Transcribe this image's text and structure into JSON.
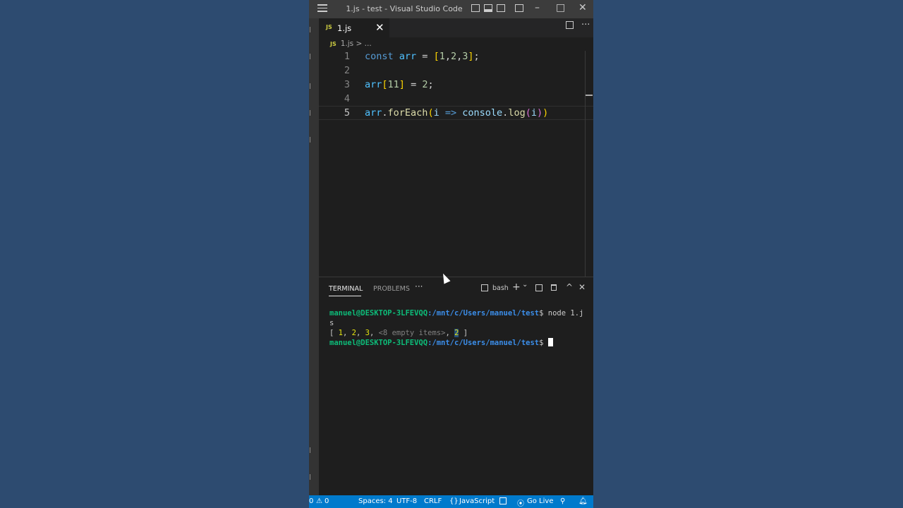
{
  "window": {
    "title": "1.js - test - Visual Studio Code",
    "minimize": "–",
    "maximize": "□",
    "close": "✕"
  },
  "tabs": [
    {
      "icon": "JS",
      "label": "1.js",
      "close": "✕"
    }
  ],
  "tab_actions": {
    "more": "···"
  },
  "breadcrumb": {
    "icon": "JS",
    "file": "1.js",
    "sep": ">",
    "more": "..."
  },
  "editor": {
    "lines": [
      {
        "n": "1",
        "text": "const arr = [1,2,3];"
      },
      {
        "n": "2",
        "text": ""
      },
      {
        "n": "3",
        "text": "arr[11] = 2;"
      },
      {
        "n": "4",
        "text": ""
      },
      {
        "n": "5",
        "text": "arr.forEach(i => console.log(i))"
      }
    ],
    "current_line": "5"
  },
  "panel": {
    "tabs": [
      {
        "label": "TERMINAL",
        "active": true
      },
      {
        "label": "PROBLEMS",
        "active": false
      }
    ],
    "more": "···",
    "shell": "bash",
    "add": "+",
    "dropdown": "⌄",
    "maximize": "^",
    "close": "✕",
    "terminal": {
      "user": "manuel@DESKTOP-3LFEVQQ",
      "path": ":/mnt/c/Users/manuel/test",
      "prompt": "$",
      "command": " node 1.j",
      "command_wrap": "s",
      "output": {
        "open": "[ ",
        "v1": "1",
        "sep1": ", ",
        "v2": "2",
        "sep2": ", ",
        "v3": "3",
        "sep3": ", ",
        "empty": "<8 empty items>",
        "sep4": ", ",
        "v4": "2",
        "close": " ]"
      }
    }
  },
  "status_bar": {
    "errors": "0",
    "warnings": "0",
    "spaces": "Spaces: 4",
    "encoding": "UTF-8",
    "eol": "CRLF",
    "language": "JavaScript",
    "golive": "Go Live"
  },
  "colors": {
    "background": "#2c4a6e",
    "editor": "#1e1e1e",
    "status_bar": "#007acc",
    "title_bar": "#3c3c3c"
  }
}
